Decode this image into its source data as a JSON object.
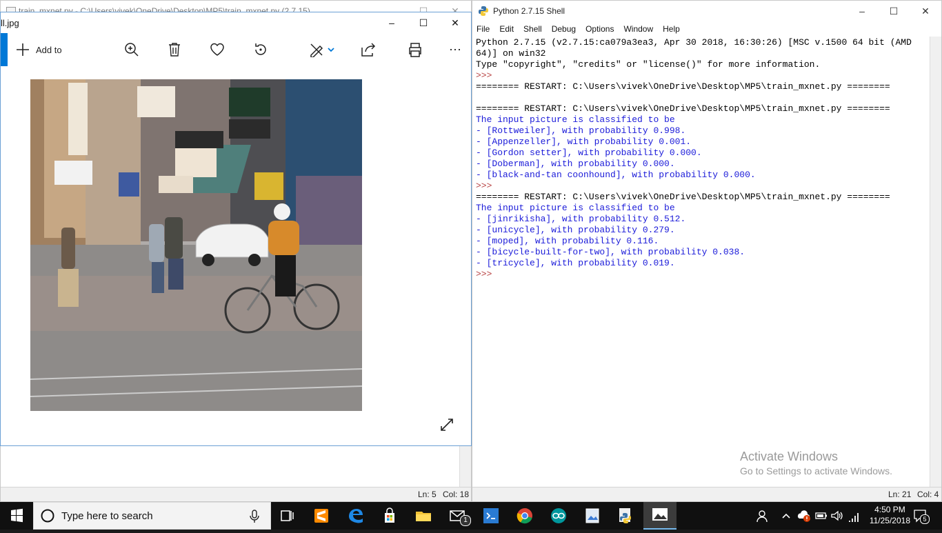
{
  "background_window": {
    "title": "train_mxnet.py - C:\\Users\\vivek\\OneDrive\\Desktop\\MP5\\train_mxnet.py (2.7.15)",
    "status_ln": "Ln: 5",
    "status_col": "Col: 18"
  },
  "photos": {
    "title": "ll.jpg",
    "toolbar": {
      "add_to_label": "Add to",
      "icons": [
        "zoom-in-icon",
        "delete-icon",
        "favorite-icon",
        "rotate-icon",
        "edit-icon",
        "share-icon",
        "print-icon",
        "more-icon"
      ]
    },
    "image_alt": "Street scene with pedestrians and a cyclist"
  },
  "shell": {
    "title": "Python 2.7.15 Shell",
    "menu": [
      "File",
      "Edit",
      "Shell",
      "Debug",
      "Options",
      "Window",
      "Help"
    ],
    "console": [
      {
        "kind": "text",
        "text": "Python 2.7.15 (v2.7.15:ca079a3ea3, Apr 30 2018, 16:30:26) [MSC v.1500 64 bit (AMD"
      },
      {
        "kind": "text",
        "text": "64)] on win32"
      },
      {
        "kind": "text",
        "text": "Type \"copyright\", \"credits\" or \"license()\" for more information."
      },
      {
        "kind": "prompt",
        "text": ">>> "
      },
      {
        "kind": "text",
        "text": "======== RESTART: C:\\Users\\vivek\\OneDrive\\Desktop\\MP5\\train_mxnet.py ========"
      },
      {
        "kind": "text",
        "text": ""
      },
      {
        "kind": "text",
        "text": "======== RESTART: C:\\Users\\vivek\\OneDrive\\Desktop\\MP5\\train_mxnet.py ========"
      },
      {
        "kind": "out",
        "text": "The input picture is classified to be"
      },
      {
        "kind": "out",
        "text": "- [Rottweiler], with probability 0.998."
      },
      {
        "kind": "out",
        "text": "- [Appenzeller], with probability 0.001."
      },
      {
        "kind": "out",
        "text": "- [Gordon setter], with probability 0.000."
      },
      {
        "kind": "out",
        "text": "- [Doberman], with probability 0.000."
      },
      {
        "kind": "out",
        "text": "- [black-and-tan coonhound], with probability 0.000."
      },
      {
        "kind": "prompt",
        "text": ">>> "
      },
      {
        "kind": "text",
        "text": "======== RESTART: C:\\Users\\vivek\\OneDrive\\Desktop\\MP5\\train_mxnet.py ========"
      },
      {
        "kind": "out",
        "text": "The input picture is classified to be"
      },
      {
        "kind": "out",
        "text": "- [jinrikisha], with probability 0.512."
      },
      {
        "kind": "out",
        "text": "- [unicycle], with probability 0.279."
      },
      {
        "kind": "out",
        "text": "- [moped], with probability 0.116."
      },
      {
        "kind": "out",
        "text": "- [bicycle-built-for-two], with probability 0.038."
      },
      {
        "kind": "out",
        "text": "- [tricycle], with probability 0.019."
      },
      {
        "kind": "prompt",
        "text": ">>> "
      }
    ],
    "status_ln": "Ln: 21",
    "status_col": "Col: 4"
  },
  "watermark": {
    "line1": "Activate Windows",
    "line2": "Go to Settings to activate Windows."
  },
  "taskbar": {
    "search_placeholder": "Type here to search",
    "apps": [
      "task-view-icon",
      "sublime-icon",
      "edge-icon",
      "store-icon",
      "file-explorer-icon",
      "mail-icon",
      "vscode-icon",
      "chrome-icon",
      "arduino-icon",
      "image-viewer-icon",
      "python-idle-icon",
      "photos-icon"
    ],
    "mail_badge": "1",
    "notification_count": "5",
    "time": "4:50 PM",
    "date": "11/25/2018"
  },
  "colors": {
    "accent": "#0078d7",
    "console_output": "#1a1ad9",
    "prompt": "#b84444"
  }
}
